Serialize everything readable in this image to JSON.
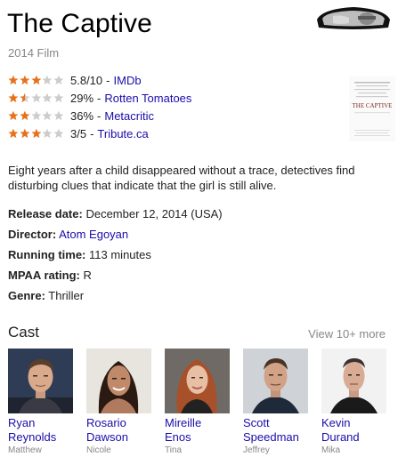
{
  "title": "The Captive",
  "subtitle": "2014 Film",
  "ratings": [
    {
      "score": "5.8/10",
      "source": "IMDb",
      "stars": 3,
      "half": false
    },
    {
      "score": "29%",
      "source": "Rotten Tomatoes",
      "stars": 1,
      "half": true
    },
    {
      "score": "36%",
      "source": "Metacritic",
      "stars": 2,
      "half": false
    },
    {
      "score": "3/5",
      "source": "Tribute.ca",
      "stars": 3,
      "half": false
    }
  ],
  "rating_separator": "-",
  "poster": {
    "text": "THE CAPTIVE"
  },
  "description": "Eight years after a child disappeared without a trace, detectives find disturbing clues that indicate that the girl is still alive.",
  "facts": {
    "release": {
      "label": "Release date:",
      "value": "December 12, 2014 (USA)"
    },
    "director": {
      "label": "Director:",
      "value": "Atom Egoyan"
    },
    "running": {
      "label": "Running time:",
      "value": "113 minutes"
    },
    "mpaa": {
      "label": "MPAA rating:",
      "value": "R"
    },
    "genre": {
      "label": "Genre:",
      "value": "Thriller"
    }
  },
  "cast_header": "Cast",
  "view_more": "View 10+ more",
  "cast": [
    {
      "first": "Ryan",
      "last": "Reynolds",
      "role": "Matthew"
    },
    {
      "first": "Rosario",
      "last": "Dawson",
      "role": "Nicole"
    },
    {
      "first": "Mireille",
      "last": "Enos",
      "role": "Tina"
    },
    {
      "first": "Scott",
      "last": "Speedman",
      "role": "Jeffrey"
    },
    {
      "first": "Kevin",
      "last": "Durand",
      "role": "Mika"
    }
  ],
  "colors": {
    "link": "#1a0dab",
    "star_filled": "#e7711b",
    "star_empty": "#cccccc",
    "muted": "#878787"
  }
}
